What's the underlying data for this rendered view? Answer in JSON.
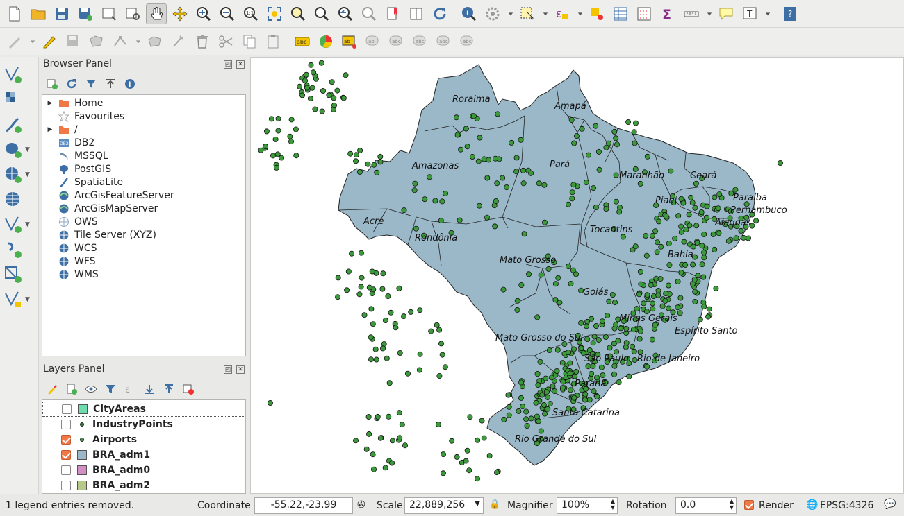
{
  "browser_panel": {
    "title": "Browser Panel",
    "items": [
      {
        "label": "Home",
        "icon": "folder-icon",
        "expandable": true
      },
      {
        "label": "Favourites",
        "icon": "star-icon",
        "expandable": false
      },
      {
        "label": "/",
        "icon": "folder-icon",
        "expandable": true
      },
      {
        "label": "DB2",
        "icon": "db2-icon",
        "expandable": false
      },
      {
        "label": "MSSQL",
        "icon": "mssql-icon",
        "expandable": false
      },
      {
        "label": "PostGIS",
        "icon": "postgis-icon",
        "expandable": false
      },
      {
        "label": "SpatiaLite",
        "icon": "spatialite-icon",
        "expandable": false
      },
      {
        "label": "ArcGisFeatureServer",
        "icon": "arcgis-icon",
        "expandable": false
      },
      {
        "label": "ArcGisMapServer",
        "icon": "arcgis-icon",
        "expandable": false
      },
      {
        "label": "OWS",
        "icon": "globe-icon",
        "expandable": false
      },
      {
        "label": "Tile Server (XYZ)",
        "icon": "globe-icon",
        "expandable": false
      },
      {
        "label": "WCS",
        "icon": "globe-icon",
        "expandable": false
      },
      {
        "label": "WFS",
        "icon": "globe-icon",
        "expandable": false
      },
      {
        "label": "WMS",
        "icon": "globe-icon",
        "expandable": false
      }
    ]
  },
  "layers_panel": {
    "title": "Layers Panel",
    "layers": [
      {
        "name": "CityAreas",
        "checked": false,
        "symbol": "polygon",
        "color": "#6fdcb0",
        "selected": true
      },
      {
        "name": "IndustryPoints",
        "checked": false,
        "symbol": "point",
        "color": "#2e7d32",
        "selected": false
      },
      {
        "name": "Airports",
        "checked": true,
        "symbol": "point",
        "color": "#3e9b3e",
        "selected": false
      },
      {
        "name": "BRA_adm1",
        "checked": true,
        "symbol": "polygon",
        "color": "#9cb8c8",
        "selected": false
      },
      {
        "name": "BRA_adm0",
        "checked": false,
        "symbol": "polygon",
        "color": "#d38fc4",
        "selected": false
      },
      {
        "name": "BRA_adm2",
        "checked": false,
        "symbol": "polygon",
        "color": "#b5c98a",
        "selected": false
      }
    ]
  },
  "map": {
    "land_color": "#9bb8c9",
    "point_color": "#3c9a3c",
    "state_labels": [
      "Roraima",
      "Amapá",
      "Amazonas",
      "Pará",
      "Maranhão",
      "Ceará",
      "Piauí",
      "Paraíba",
      "Pernambuco",
      "Alagoas",
      "Acre",
      "Tocantins",
      "Rondônia",
      "Mato Grosso",
      "Bahia",
      "Goiás",
      "Minas Gerais",
      "Espírito Santo",
      "Mato Grosso do Sul",
      "São Paulo",
      "Rio de Janeiro",
      "Paraná",
      "Santa Catarina",
      "Rio Grande do Sul"
    ]
  },
  "status": {
    "message": "1 legend entries removed.",
    "coordinate_label": "Coordinate",
    "coordinate_value": "-55.22,-23.99",
    "scale_label": "Scale",
    "scale_value": "22,889,256",
    "magnifier_label": "Magnifier",
    "magnifier_value": "100%",
    "rotation_label": "Rotation",
    "rotation_value": "0.0",
    "render_label": "Render",
    "crs_label": "EPSG:4326"
  }
}
